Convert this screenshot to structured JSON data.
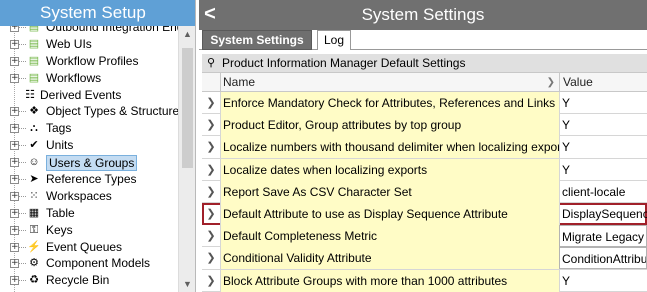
{
  "left_panel": {
    "title": "System Setup",
    "tree_items": [
      {
        "label": "Outbound Integration Endp",
        "icon": "folder-icon",
        "glyph": "▤",
        "partial": true
      },
      {
        "label": "Web UIs",
        "icon": "folder-icon",
        "glyph": "▤"
      },
      {
        "label": "Workflow Profiles",
        "icon": "folder-icon",
        "glyph": "▤"
      },
      {
        "label": "Workflows",
        "icon": "folder-icon",
        "glyph": "▤"
      },
      {
        "label": "Derived Events",
        "icon": "document-icon",
        "glyph": "☷",
        "no_expander": true
      },
      {
        "label": "Object Types & Structures",
        "icon": "structure-icon",
        "glyph": "❖"
      },
      {
        "label": "Tags",
        "icon": "tags-icon",
        "glyph": "⛬"
      },
      {
        "label": "Units",
        "icon": "units-icon",
        "glyph": "✔"
      },
      {
        "label": "Users & Groups",
        "icon": "users-icon",
        "glyph": "☺",
        "selected": true
      },
      {
        "label": "Reference Types",
        "icon": "reference-icon",
        "glyph": "➤"
      },
      {
        "label": "Workspaces",
        "icon": "workspaces-icon",
        "glyph": "⁙"
      },
      {
        "label": "Table",
        "icon": "table-icon",
        "glyph": "▦"
      },
      {
        "label": "Keys",
        "icon": "keys-icon",
        "glyph": "⚿"
      },
      {
        "label": "Event Queues",
        "icon": "event-queue-icon",
        "glyph": "⚡"
      },
      {
        "label": "Component Models",
        "icon": "component-icon",
        "glyph": "⚙"
      },
      {
        "label": "Recycle Bin",
        "icon": "recycle-bin-icon",
        "glyph": "♻"
      }
    ]
  },
  "right_panel": {
    "back_glyph": "<",
    "title": "System Settings",
    "tabs": [
      {
        "label": "System Settings",
        "active": true
      },
      {
        "label": "Log",
        "active": false
      }
    ],
    "grid_title": "Product Information Manager Default Settings",
    "columns": {
      "name": "Name",
      "value": "Value"
    },
    "rows": [
      {
        "name": "Enforce Mandatory Check for Attributes, References and Links",
        "value": "Y"
      },
      {
        "name": "Product Editor, Group attributes by top group",
        "value": "Y"
      },
      {
        "name": "Localize numbers with thousand delimiter when localizing exports",
        "value": "Y"
      },
      {
        "name": "Localize dates when localizing exports",
        "value": "Y"
      },
      {
        "name": "Report Save As CSV Character Set",
        "value": "client-locale"
      },
      {
        "name": "Default Attribute to use as Display Sequence Attribute",
        "value": "DisplaySequence",
        "highlighted": true
      },
      {
        "name": "Default Completeness Metric",
        "value": "Migrate Legacy Co",
        "bordered": true
      },
      {
        "name": "Conditional Validity Attribute",
        "value": "ConditionAttribute",
        "bordered": true
      },
      {
        "name": "Block Attribute Groups with more than 1000 attributes",
        "value": "Y"
      }
    ]
  },
  "colors": {
    "left_header": "#5fa0d6",
    "right_header": "#707070",
    "name_cell_bg": "#fffcc6",
    "highlight_border": "#a0202a",
    "selected_item_bg": "#c4dcf2"
  }
}
